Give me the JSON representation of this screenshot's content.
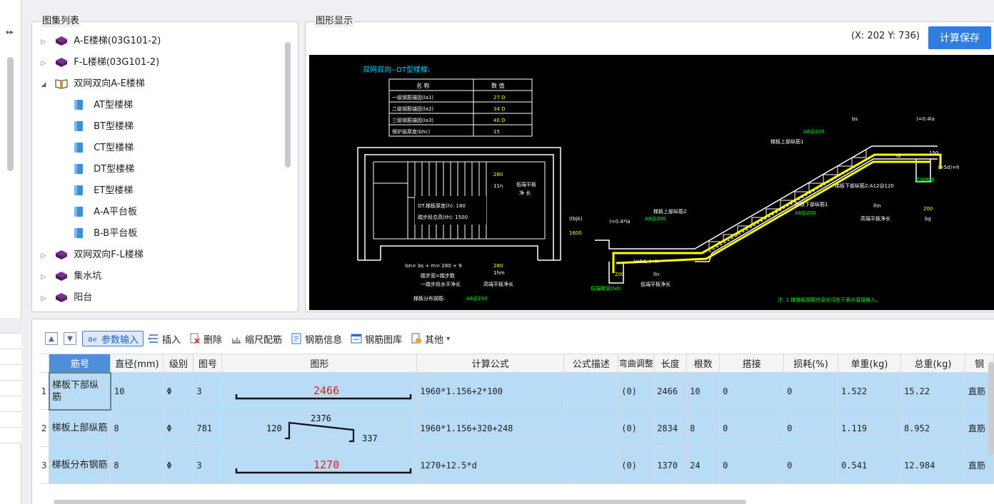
{
  "left_strip": {
    "collapse_glyph": "▸▸"
  },
  "tree_panel": {
    "title": "图集列表",
    "nodes": [
      {
        "label": "A-E楼梯(03G101-2)",
        "arrow": "▷",
        "icon": "book-icon"
      },
      {
        "label": "F-L楼梯(03G101-2)",
        "arrow": "▷",
        "icon": "book-icon"
      },
      {
        "label": "双网双向A-E楼梯",
        "arrow": "◢",
        "icon": "open-book-icon"
      },
      {
        "label": "AT型楼梯",
        "icon": "doc-icon"
      },
      {
        "label": "BT型楼梯",
        "icon": "doc-icon"
      },
      {
        "label": "CT型楼梯",
        "icon": "doc-icon"
      },
      {
        "label": "DT型楼梯",
        "icon": "doc-icon",
        "selected": true
      },
      {
        "label": "ET型楼梯",
        "icon": "doc-icon"
      },
      {
        "label": "A-A平台板",
        "icon": "doc-icon"
      },
      {
        "label": "B-B平台板",
        "icon": "doc-icon"
      },
      {
        "label": "双网双向F-L楼梯",
        "arrow": "▷",
        "icon": "book-icon"
      },
      {
        "label": "集水坑",
        "arrow": "▷",
        "icon": "book-icon"
      },
      {
        "label": "阳台",
        "arrow": "▷",
        "icon": "book-icon"
      }
    ]
  },
  "draw_panel": {
    "title": "图形显示",
    "coords": "(X: 202 Y: 736)",
    "calc_save": "计算保存",
    "drawing": {
      "heading": "双网双向--DT型楼梯:",
      "table_header": [
        "名 称",
        "数 值"
      ],
      "table_rows": [
        [
          "一级钢筋锚固(la1)",
          "27 D"
        ],
        [
          "二级钢筋锚固(la2)",
          "34 D"
        ],
        [
          "三级钢筋锚固(la3)",
          "40 D"
        ],
        [
          "保护层厚度(bhc)",
          "15"
        ]
      ],
      "plan_labels": {
        "thickness": "DT.梯板厚度(h): 180",
        "total_height": "踏步段总高(th): 1500",
        "span": "lsn= bs + m= 280 + 9",
        "step_width": "踏步宽=踏步数",
        "step_level": "一踏步段水平净长",
        "high_platform": "高端平板净长",
        "distribution": "梯板分布钢筋:",
        "distribution_val": "A8@250",
        "v280a": "280",
        "v11n": "11n",
        "low_platform_left": "低端平板",
        "low_platform_left2": "净 长",
        "v280b": "280",
        "vlhm": "1hm"
      },
      "section_labels": {
        "a8200_top": "A8@200",
        "top_rebar1": "梯板上部纵筋1",
        "bs": "bs",
        "d04la": ")=0.4la",
        "la": "la",
        "v150": "150",
        "v5d": ")=5d)=h",
        "high_beam": "高端梯梁",
        "bottom_rebar2": "梯板下部纵筋2:A12@120",
        "bottom_rebar1": "梯板下部纵筋1",
        "a8200_mid": "A8@200",
        "lhn": "lhn",
        "v200_right": "200",
        "high_plat_len": "高端平板净长",
        "bg": "bg",
        "top_rebar2": "梯板上部纵筋2",
        "a8200_left": "A8@200",
        "tbjk": "(tbjk)",
        "v1600": "1600",
        "v04la_left": ")=0.4*la",
        "v5dh": ")=5d, )=h",
        "v200_left": "200",
        "lln": "lln",
        "low_beam": "低端梯梁(bd)",
        "low_plat_len": "低端平板净长",
        "note": "注: 1.楼梯板钢筋信息也可在下表中直接输入。"
      }
    }
  },
  "toolbar": {
    "items": [
      {
        "label": "参数输入",
        "icon": "param-icon",
        "active": true
      },
      {
        "label": "插入",
        "icon": "insert-icon"
      },
      {
        "label": "删除",
        "icon": "delete-icon"
      },
      {
        "label": "缩尺配筋",
        "icon": "scale-icon"
      },
      {
        "label": "钢筋信息",
        "icon": "info-icon"
      },
      {
        "label": "钢筋图库",
        "icon": "library-icon"
      },
      {
        "label": "其他",
        "icon": "other-icon",
        "dropdown": "▾"
      }
    ]
  },
  "grid": {
    "headers": [
      "筋号",
      "直径(mm)",
      "级别",
      "图号",
      "图形",
      "计算公式",
      "公式描述",
      "弯曲调整",
      "长度",
      "根数",
      "搭接",
      "损耗(%)",
      "单重(kg)",
      "总重(kg)",
      "钢"
    ],
    "rows": [
      {
        "num": "1",
        "name": "梯板下部纵筋",
        "diameter": "10",
        "grade": "Φ",
        "fig": "3",
        "shape_value": "2466",
        "formula": "1960*1.156+2*100",
        "desc": "",
        "bend": "(0)",
        "length": "2466",
        "count": "10",
        "lap": "0",
        "loss": "0",
        "unit_wt": "1.522",
        "total_wt": "15.22",
        "type": "直筋"
      },
      {
        "num": "2",
        "name": "梯板上部纵筋",
        "diameter": "8",
        "grade": "Φ",
        "fig": "781",
        "shape_a": "120",
        "shape_b": "2376",
        "shape_c": "337",
        "formula": "1960*1.156+320+248",
        "desc": "",
        "bend": "(0)",
        "length": "2834",
        "count": "8",
        "lap": "0",
        "loss": "0",
        "unit_wt": "1.119",
        "total_wt": "8.952",
        "type": "直筋"
      },
      {
        "num": "3",
        "name": "梯板分布钢筋",
        "diameter": "8",
        "grade": "Φ",
        "fig": "3",
        "shape_value": "1270",
        "formula": "1270+12.5*d",
        "desc": "",
        "bend": "(0)",
        "length": "1370",
        "count": "24",
        "lap": "0",
        "loss": "0",
        "unit_wt": "0.541",
        "total_wt": "12.984",
        "type": "直筋"
      }
    ]
  }
}
